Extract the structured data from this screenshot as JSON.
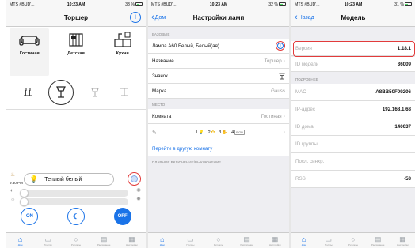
{
  "status": {
    "s1": {
      "carrier": "MTS #BUD'...",
      "time": "10:23 AM",
      "battery": "33 %"
    },
    "s2": {
      "carrier": "MTS #BUD'...",
      "time": "10:23 AM",
      "battery": "32 %"
    },
    "s3": {
      "carrier": "MTS #BUD'...",
      "time": "10:23 AM",
      "battery": "31 %"
    }
  },
  "screen1": {
    "title": "Торшер",
    "add_icon": "plus-circle-icon",
    "rooms": [
      {
        "label": "Гостиная",
        "icon": "sofa-icon"
      },
      {
        "label": "Детская",
        "icon": "crib-icon"
      },
      {
        "label": "Кухня",
        "icon": "kitchen-icon"
      }
    ],
    "time": "9:30 PM",
    "preset": "Теплый белый",
    "btn_on": "ON",
    "btn_off": "OFF",
    "brightness": 0.0,
    "temperature": 0.0
  },
  "screen2": {
    "back": "Дом",
    "title": "Настройки ламп",
    "section_basic": "БАЗОВЫЕ",
    "lamp_name": "Лампа A60 Белый, Белый(ая)",
    "rows": [
      {
        "k": "Название",
        "v": "Торшер"
      },
      {
        "k": "Значок",
        "v": ""
      },
      {
        "k": "Марка",
        "v": "Gauss"
      }
    ],
    "section_place": "МЕСТО",
    "room_row": {
      "k": "Комната",
      "v": "Гостиная"
    },
    "color_items": [
      "1",
      "2",
      "3",
      "4"
    ],
    "color_badge": "RGB",
    "link": "Перейти в другую комнату",
    "section_smooth": "ПЛАВНОЕ ВКЛЮЧЕНИЕ/ВЫКЛЮЧЕНИЕ"
  },
  "screen3": {
    "back": "Назад",
    "title": "Модель",
    "version": {
      "k": "Версия",
      "v": "1.18.1"
    },
    "model_id": {
      "k": "ID модели",
      "v": "36009"
    },
    "section_more": "ПОДРОБНЕЕ",
    "rows": [
      {
        "k": "MAC",
        "v": "A8BB50F09206"
      },
      {
        "k": "IP-адрес",
        "v": "192.168.1.68"
      },
      {
        "k": "ID дома",
        "v": "140037"
      },
      {
        "k": "ID группы",
        "v": ""
      },
      {
        "k": "Посл. синхр.",
        "v": ""
      },
      {
        "k": "RSSI",
        "v": "-53"
      }
    ]
  },
  "tabs": [
    {
      "label": "Дом",
      "icon": "home-icon"
    },
    {
      "label": "Группы",
      "icon": "groups-icon"
    },
    {
      "label": "Ритуалы",
      "icon": "rituals-icon"
    },
    {
      "label": "Расписание",
      "icon": "schedule-icon"
    },
    {
      "label": "Настройки",
      "icon": "settings-icon"
    }
  ],
  "colors": {
    "accent": "#1a73e8",
    "highlight": "#e23b3b",
    "bulb": "#f0b400"
  }
}
